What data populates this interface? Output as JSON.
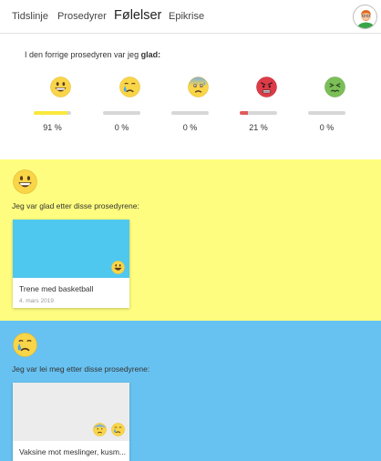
{
  "nav": {
    "tabs": [
      {
        "label": "Tidslinje"
      },
      {
        "label": "Prosedyrer"
      },
      {
        "label": "Følelser"
      },
      {
        "label": "Epikrise"
      }
    ],
    "active_tab": "Følelser"
  },
  "summary": {
    "intro_prefix": "I den forrige prosedyren var jeg ",
    "intro_emotion": "glad:",
    "emotions": [
      {
        "icon": "grinning-face-icon",
        "percent": 91,
        "label": "91 %",
        "color": "#f9e83b"
      },
      {
        "icon": "crying-face-icon",
        "percent": 0,
        "label": "0 %",
        "color": "#d7d7d7"
      },
      {
        "icon": "anxious-face-icon",
        "percent": 0,
        "label": "0 %",
        "color": "#d7d7d7"
      },
      {
        "icon": "angry-face-icon",
        "percent": 21,
        "label": "21 %",
        "color": "#e05a5a"
      },
      {
        "icon": "nauseated-face-icon",
        "percent": 0,
        "label": "0 %",
        "color": "#d7d7d7"
      }
    ]
  },
  "sections": {
    "glad": {
      "background": "#fefd7f",
      "icon": "grinning-face-icon",
      "caption": "Jeg var glad etter disse prosedyrene:",
      "cards": [
        {
          "title": "Trene med basketball",
          "date": "4. mars 2019",
          "thumb_color": "#4fc8ef",
          "icons": [
            "grinning-face-icon"
          ]
        }
      ]
    },
    "sad": {
      "background": "#68c2f1",
      "icon": "crying-face-icon",
      "caption": "Jeg var lei meg etter disse prosedyrene:",
      "cards": [
        {
          "title": "Vaksine mot meslinger, kusm...",
          "thumb_color": "#ececec",
          "icons": [
            "anxious-face-icon",
            "crying-face-icon"
          ]
        }
      ]
    }
  }
}
